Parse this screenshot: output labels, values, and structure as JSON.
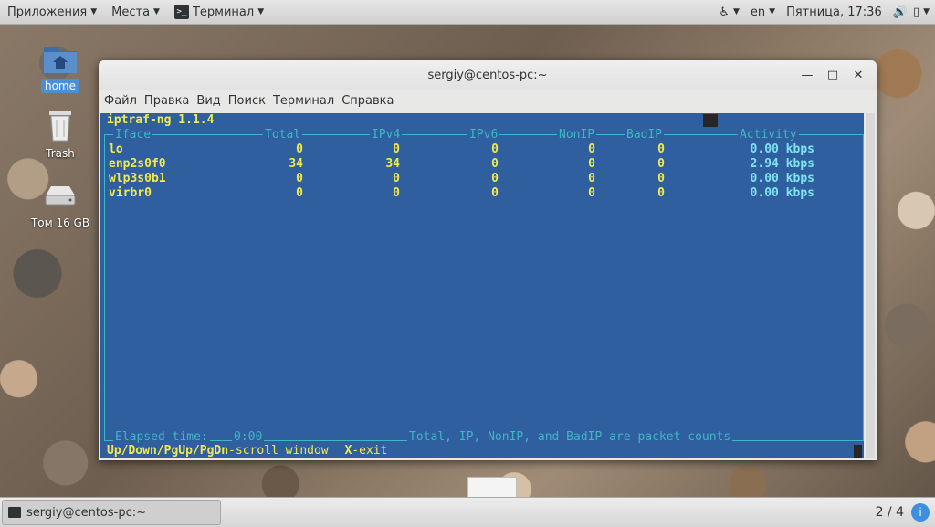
{
  "topbar": {
    "apps": "Приложения",
    "places": "Места",
    "terminal": "Терминал",
    "lang": "en",
    "clock": "Пятница, 17:36",
    "icons": [
      "accessibility-icon",
      "volume-icon",
      "battery-icon"
    ]
  },
  "desktop": {
    "icons": [
      {
        "label": "home",
        "icon": "folder-home-icon"
      },
      {
        "label": "Trash",
        "icon": "trash-icon"
      },
      {
        "label": "Том 16 GB",
        "icon": "drive-icon"
      }
    ]
  },
  "window": {
    "title": "sergiy@centos-pc:~",
    "menu": [
      "Файл",
      "Правка",
      "Вид",
      "Поиск",
      "Терминал",
      "Справка"
    ]
  },
  "terminal": {
    "program": "iptraf-ng 1.1.4",
    "headers": [
      "Iface",
      "Total",
      "IPv4",
      "IPv6",
      "NonIP",
      "BadIP",
      "Activity"
    ],
    "rows": [
      {
        "iface": "lo",
        "total": "0",
        "ipv4": "0",
        "ipv6": "0",
        "nonip": "0",
        "badip": "0",
        "activity": "0.00 kbps"
      },
      {
        "iface": "enp2s0f0",
        "total": "34",
        "ipv4": "34",
        "ipv6": "0",
        "nonip": "0",
        "badip": "0",
        "activity": "2.94 kbps"
      },
      {
        "iface": "wlp3s0b1",
        "total": "0",
        "ipv4": "0",
        "ipv6": "0",
        "nonip": "0",
        "badip": "0",
        "activity": "0.00 kbps"
      },
      {
        "iface": "virbr0",
        "total": "0",
        "ipv4": "0",
        "ipv6": "0",
        "nonip": "0",
        "badip": "0",
        "activity": "0.00 kbps"
      }
    ],
    "elapsed_label": "Elapsed time:",
    "elapsed_value": "0:00",
    "note": "Total, IP, NonIP, and BadIP are packet counts",
    "help_scroll_key": "Up/Down/PgUp/PgDn",
    "help_scroll_text": "-scroll window",
    "help_exit_key": "X",
    "help_exit_text": "-exit"
  },
  "taskbar": {
    "task": "sergiy@centos-pc:~",
    "workspace": "2 / 4"
  }
}
